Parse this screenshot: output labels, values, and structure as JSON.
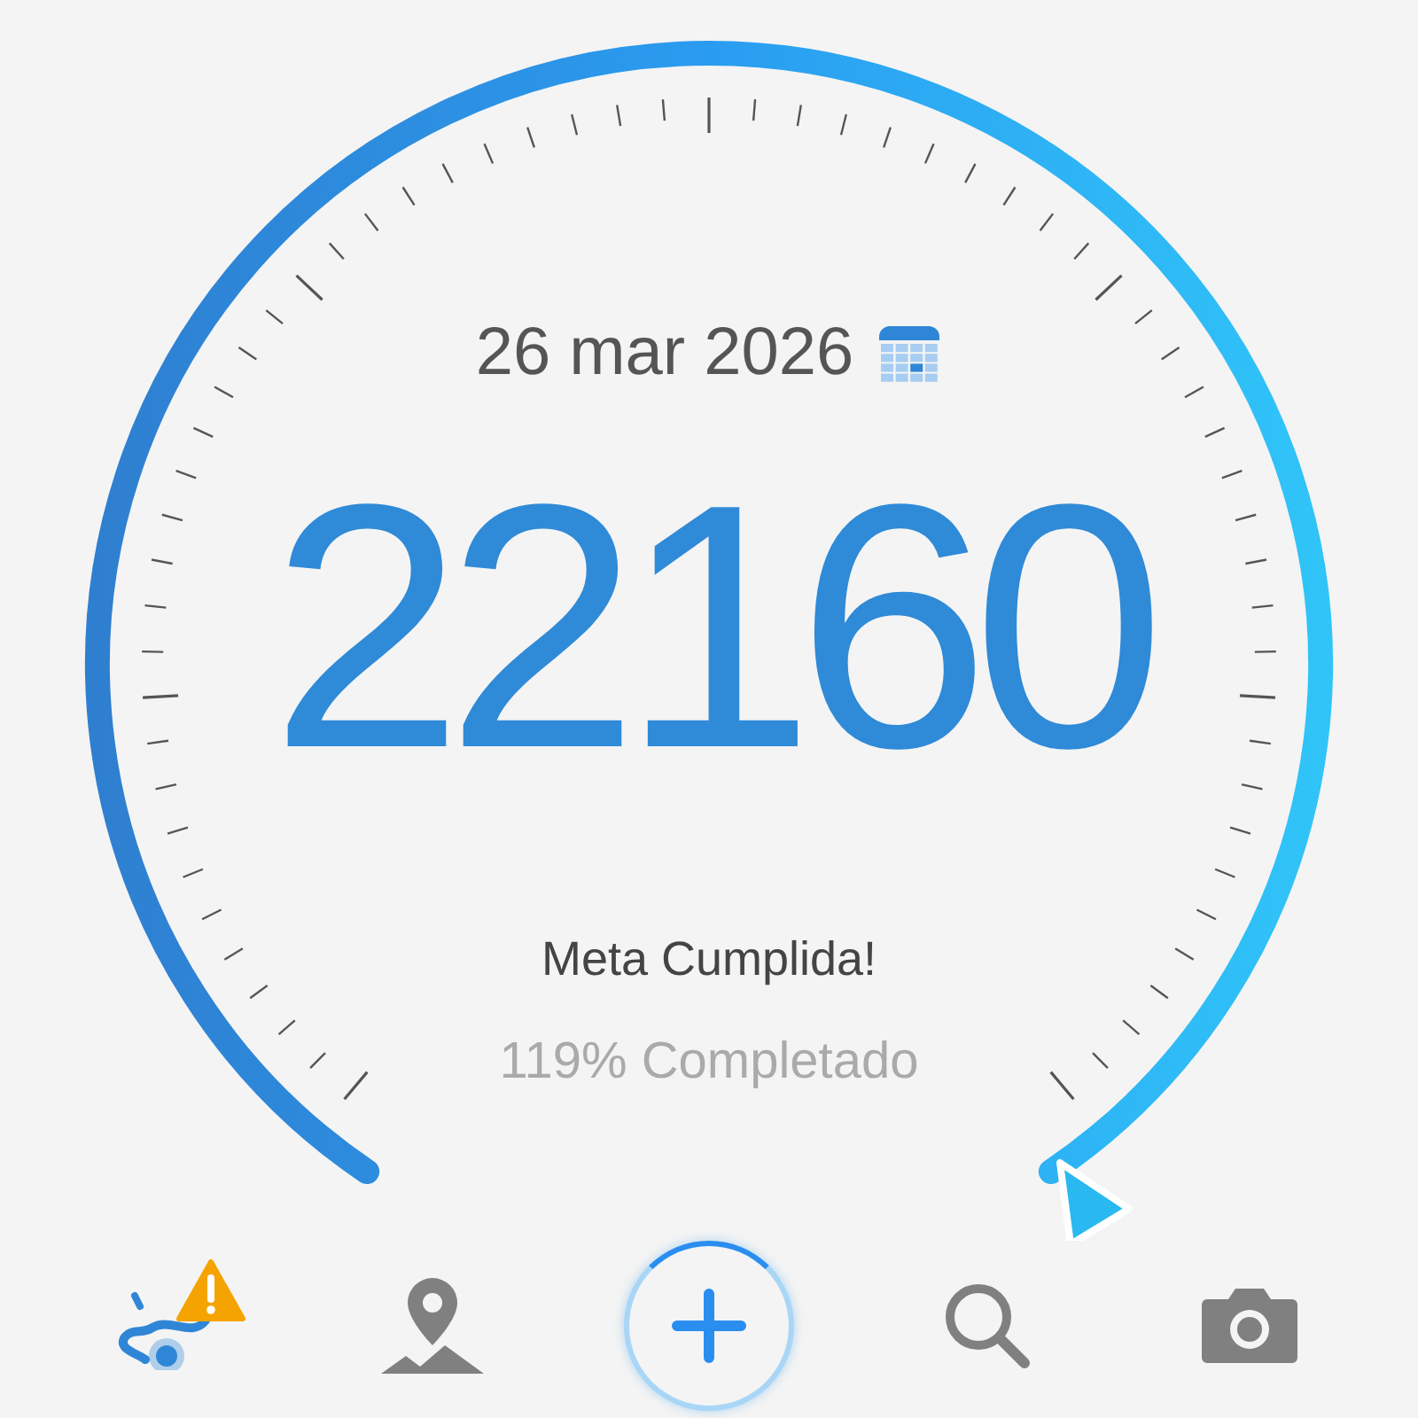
{
  "date": "26 mar 2026",
  "steps": "22160",
  "status": "Meta Cumplida!",
  "progress_text": "119% Completado",
  "nav": [
    {
      "kind": "route",
      "selected": true,
      "alert": true
    },
    {
      "kind": "map",
      "selected": false
    },
    {
      "kind": "add",
      "selected": false
    },
    {
      "kind": "search",
      "selected": false
    },
    {
      "kind": "camera",
      "selected": false
    }
  ]
}
